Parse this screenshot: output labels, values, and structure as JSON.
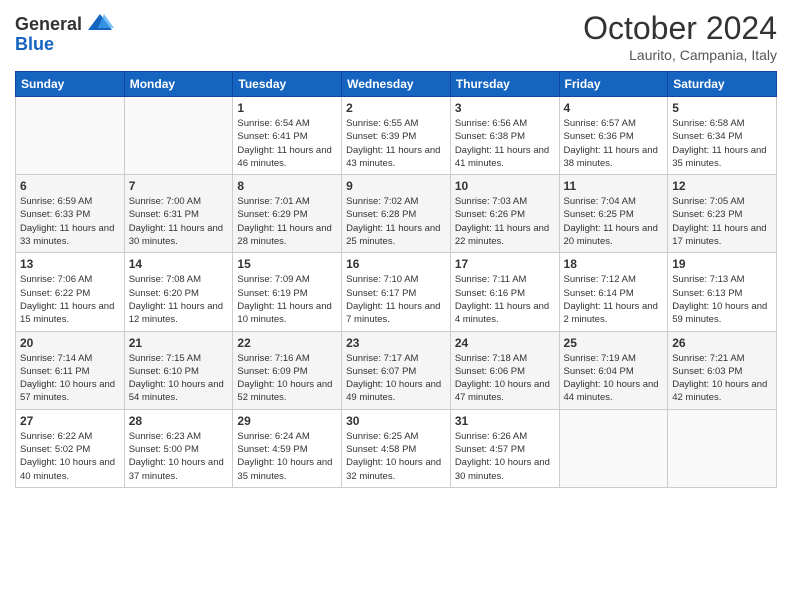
{
  "header": {
    "logo_general": "General",
    "logo_blue": "Blue",
    "month_title": "October 2024",
    "location": "Laurito, Campania, Italy"
  },
  "days_of_week": [
    "Sunday",
    "Monday",
    "Tuesday",
    "Wednesday",
    "Thursday",
    "Friday",
    "Saturday"
  ],
  "weeks": [
    [
      {
        "day": "",
        "info": ""
      },
      {
        "day": "",
        "info": ""
      },
      {
        "day": "1",
        "info": "Sunrise: 6:54 AM\nSunset: 6:41 PM\nDaylight: 11 hours and 46 minutes."
      },
      {
        "day": "2",
        "info": "Sunrise: 6:55 AM\nSunset: 6:39 PM\nDaylight: 11 hours and 43 minutes."
      },
      {
        "day": "3",
        "info": "Sunrise: 6:56 AM\nSunset: 6:38 PM\nDaylight: 11 hours and 41 minutes."
      },
      {
        "day": "4",
        "info": "Sunrise: 6:57 AM\nSunset: 6:36 PM\nDaylight: 11 hours and 38 minutes."
      },
      {
        "day": "5",
        "info": "Sunrise: 6:58 AM\nSunset: 6:34 PM\nDaylight: 11 hours and 35 minutes."
      }
    ],
    [
      {
        "day": "6",
        "info": "Sunrise: 6:59 AM\nSunset: 6:33 PM\nDaylight: 11 hours and 33 minutes."
      },
      {
        "day": "7",
        "info": "Sunrise: 7:00 AM\nSunset: 6:31 PM\nDaylight: 11 hours and 30 minutes."
      },
      {
        "day": "8",
        "info": "Sunrise: 7:01 AM\nSunset: 6:29 PM\nDaylight: 11 hours and 28 minutes."
      },
      {
        "day": "9",
        "info": "Sunrise: 7:02 AM\nSunset: 6:28 PM\nDaylight: 11 hours and 25 minutes."
      },
      {
        "day": "10",
        "info": "Sunrise: 7:03 AM\nSunset: 6:26 PM\nDaylight: 11 hours and 22 minutes."
      },
      {
        "day": "11",
        "info": "Sunrise: 7:04 AM\nSunset: 6:25 PM\nDaylight: 11 hours and 20 minutes."
      },
      {
        "day": "12",
        "info": "Sunrise: 7:05 AM\nSunset: 6:23 PM\nDaylight: 11 hours and 17 minutes."
      }
    ],
    [
      {
        "day": "13",
        "info": "Sunrise: 7:06 AM\nSunset: 6:22 PM\nDaylight: 11 hours and 15 minutes."
      },
      {
        "day": "14",
        "info": "Sunrise: 7:08 AM\nSunset: 6:20 PM\nDaylight: 11 hours and 12 minutes."
      },
      {
        "day": "15",
        "info": "Sunrise: 7:09 AM\nSunset: 6:19 PM\nDaylight: 11 hours and 10 minutes."
      },
      {
        "day": "16",
        "info": "Sunrise: 7:10 AM\nSunset: 6:17 PM\nDaylight: 11 hours and 7 minutes."
      },
      {
        "day": "17",
        "info": "Sunrise: 7:11 AM\nSunset: 6:16 PM\nDaylight: 11 hours and 4 minutes."
      },
      {
        "day": "18",
        "info": "Sunrise: 7:12 AM\nSunset: 6:14 PM\nDaylight: 11 hours and 2 minutes."
      },
      {
        "day": "19",
        "info": "Sunrise: 7:13 AM\nSunset: 6:13 PM\nDaylight: 10 hours and 59 minutes."
      }
    ],
    [
      {
        "day": "20",
        "info": "Sunrise: 7:14 AM\nSunset: 6:11 PM\nDaylight: 10 hours and 57 minutes."
      },
      {
        "day": "21",
        "info": "Sunrise: 7:15 AM\nSunset: 6:10 PM\nDaylight: 10 hours and 54 minutes."
      },
      {
        "day": "22",
        "info": "Sunrise: 7:16 AM\nSunset: 6:09 PM\nDaylight: 10 hours and 52 minutes."
      },
      {
        "day": "23",
        "info": "Sunrise: 7:17 AM\nSunset: 6:07 PM\nDaylight: 10 hours and 49 minutes."
      },
      {
        "day": "24",
        "info": "Sunrise: 7:18 AM\nSunset: 6:06 PM\nDaylight: 10 hours and 47 minutes."
      },
      {
        "day": "25",
        "info": "Sunrise: 7:19 AM\nSunset: 6:04 PM\nDaylight: 10 hours and 44 minutes."
      },
      {
        "day": "26",
        "info": "Sunrise: 7:21 AM\nSunset: 6:03 PM\nDaylight: 10 hours and 42 minutes."
      }
    ],
    [
      {
        "day": "27",
        "info": "Sunrise: 6:22 AM\nSunset: 5:02 PM\nDaylight: 10 hours and 40 minutes."
      },
      {
        "day": "28",
        "info": "Sunrise: 6:23 AM\nSunset: 5:00 PM\nDaylight: 10 hours and 37 minutes."
      },
      {
        "day": "29",
        "info": "Sunrise: 6:24 AM\nSunset: 4:59 PM\nDaylight: 10 hours and 35 minutes."
      },
      {
        "day": "30",
        "info": "Sunrise: 6:25 AM\nSunset: 4:58 PM\nDaylight: 10 hours and 32 minutes."
      },
      {
        "day": "31",
        "info": "Sunrise: 6:26 AM\nSunset: 4:57 PM\nDaylight: 10 hours and 30 minutes."
      },
      {
        "day": "",
        "info": ""
      },
      {
        "day": "",
        "info": ""
      }
    ]
  ]
}
